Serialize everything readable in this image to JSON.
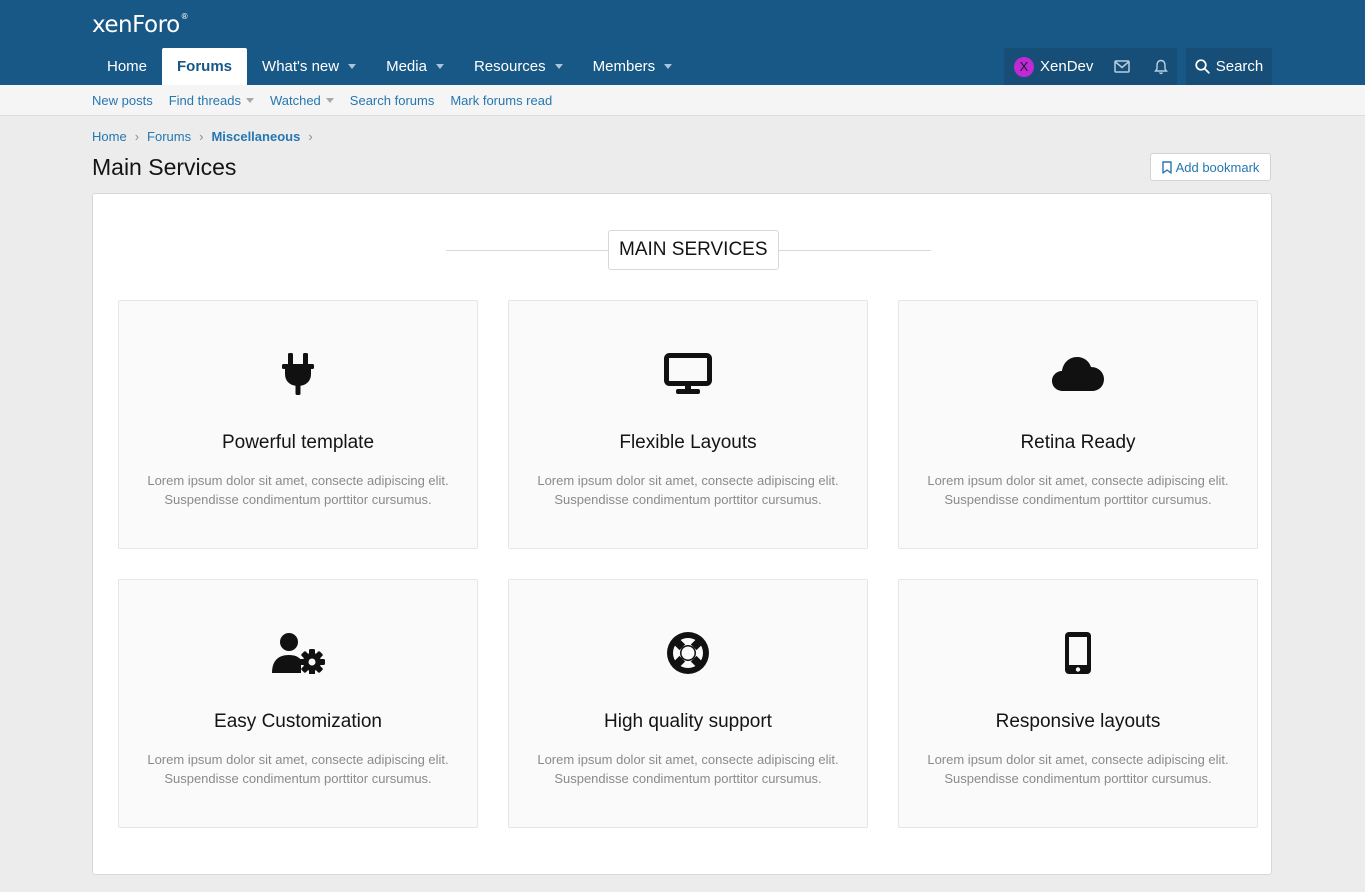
{
  "header": {
    "logo_text": "xenForo",
    "logo_mark": "®",
    "tabs": [
      {
        "label": "Home",
        "selected": false,
        "has_menu": false
      },
      {
        "label": "Forums",
        "selected": true,
        "has_menu": false
      },
      {
        "label": "What's new",
        "selected": false,
        "has_menu": true
      },
      {
        "label": "Media",
        "selected": false,
        "has_menu": true
      },
      {
        "label": "Resources",
        "selected": false,
        "has_menu": true
      },
      {
        "label": "Members",
        "selected": false,
        "has_menu": true
      }
    ],
    "account": {
      "avatar_letter": "X",
      "username": "XenDev",
      "avatar_color": "#c129d6"
    },
    "search_label": "Search"
  },
  "subnav": {
    "items": [
      {
        "label": "New posts",
        "has_menu": false
      },
      {
        "label": "Find threads",
        "has_menu": true
      },
      {
        "label": "Watched",
        "has_menu": true
      },
      {
        "label": "Search forums",
        "has_menu": false
      },
      {
        "label": "Mark forums read",
        "has_menu": false
      }
    ]
  },
  "breadcrumb": [
    "Home",
    "Forums",
    "Miscellaneous"
  ],
  "page": {
    "title": "Main Services",
    "bookmark_label": "Add bookmark"
  },
  "services": {
    "heading": "MAIN SERVICES",
    "cards": [
      {
        "icon": "plug-icon",
        "title": "Powerful template",
        "desc": "Lorem ipsum dolor sit amet, consecte adipiscing elit. Suspendisse condimentum porttitor cursumus."
      },
      {
        "icon": "desktop-icon",
        "title": "Flexible Layouts",
        "desc": "Lorem ipsum dolor sit amet, consecte adipiscing elit. Suspendisse condimentum porttitor cursumus."
      },
      {
        "icon": "cloud-icon",
        "title": "Retina Ready",
        "desc": "Lorem ipsum dolor sit amet, consecte adipiscing elit. Suspendisse condimentum porttitor cursumus."
      },
      {
        "icon": "user-gear-icon",
        "title": "Easy Customization",
        "desc": "Lorem ipsum dolor sit amet, consecte adipiscing elit. Suspendisse condimentum porttitor cursumus."
      },
      {
        "icon": "life-ring-icon",
        "title": "High quality support",
        "desc": "Lorem ipsum dolor sit amet, consecte adipiscing elit. Suspendisse condimentum porttitor cursumus."
      },
      {
        "icon": "mobile-icon",
        "title": "Responsive layouts",
        "desc": "Lorem ipsum dolor sit amet, consecte adipiscing elit. Suspendisse condimentum porttitor cursumus."
      }
    ]
  },
  "colors": {
    "header_bg": "#185886",
    "link": "#2577b1",
    "panel_bg": "#ffffff",
    "page_bg": "#ececec"
  }
}
